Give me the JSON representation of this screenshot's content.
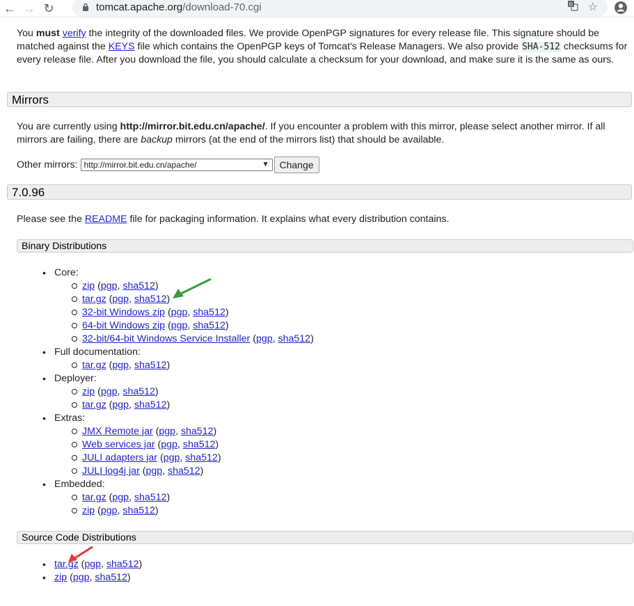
{
  "browser": {
    "url_host": "tomcat.apache.org",
    "url_path": "/download-70.cgi"
  },
  "intro": {
    "t1": "You ",
    "must": "must",
    "t2": " ",
    "verify": "verify",
    "t3": " the integrity of the downloaded files. We provide OpenPGP signatures for every release file. This signature should be matched against the ",
    "keys": "KEYS",
    "t4": " file which contains the OpenPGP keys of Tomcat's Release Managers. We also provide ",
    "sha": "SHA-512",
    "t5": " checksums for every release file. After you download the file, you should calculate a checksum for your download, and make sure it is the same as ours."
  },
  "mirrors": {
    "heading": "Mirrors",
    "t1": "You are currently using ",
    "current": "http://mirror.bit.edu.cn/apache/",
    "t2": ". If you encounter a problem with this mirror, please select another mirror. If all mirrors are failing, there are ",
    "backup": "backup",
    "t3": " mirrors (at the end of the mirrors list) that should be available.",
    "other_label": "Other mirrors: ",
    "select_value": "http://mirror.bit.edu.cn/apache/",
    "change_button": "Change"
  },
  "version": {
    "heading": "7.0.96",
    "t1": "Please see the ",
    "readme": "README",
    "t2": " file for packaging information. It explains what every distribution contains."
  },
  "binary": {
    "heading": "Binary Distributions",
    "groups": [
      {
        "label": "Core:",
        "items": [
          "zip",
          "tar.gz",
          "32-bit Windows zip",
          "64-bit Windows zip",
          "32-bit/64-bit Windows Service Installer"
        ]
      },
      {
        "label": "Full documentation:",
        "items": [
          "tar.gz"
        ]
      },
      {
        "label": "Deployer:",
        "items": [
          "zip",
          "tar.gz"
        ]
      },
      {
        "label": "Extras:",
        "items": [
          "JMX Remote jar",
          "Web services jar",
          "JULI adapters jar",
          "JULI log4j jar"
        ]
      },
      {
        "label": "Embedded:",
        "items": [
          "tar.gz",
          "zip"
        ]
      }
    ]
  },
  "source": {
    "heading": "Source Code Distributions",
    "items": [
      "tar.gz",
      "zip"
    ]
  },
  "common": {
    "pgp": "pgp",
    "sha512": "sha512",
    "open": " (",
    "sep": ", ",
    "close": ")"
  },
  "colors": {
    "link": "#2222cc",
    "green_arrow": "#3c9b3c",
    "red_arrow": "#e53935"
  }
}
